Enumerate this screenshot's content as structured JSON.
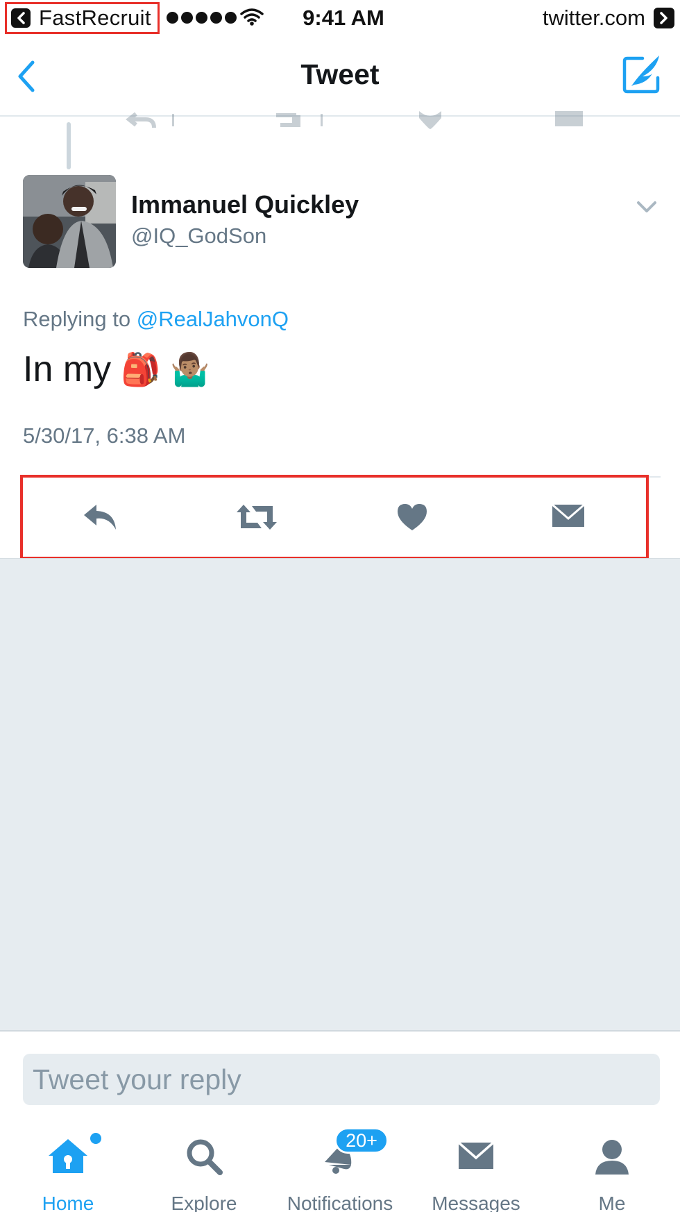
{
  "status_bar": {
    "back_app_label": "FastRecruit",
    "time": "9:41 AM",
    "site": "twitter.com"
  },
  "nav": {
    "title": "Tweet"
  },
  "tweet": {
    "author_name": "Immanuel Quickley",
    "author_handle": "@IQ_GodSon",
    "replying_prefix": "Replying to",
    "replying_to": "@RealJahvonQ",
    "text": "In my",
    "emoji": [
      "🎒",
      "🤷🏽‍♂️"
    ],
    "timestamp": "5/30/17, 6:38 AM"
  },
  "actions": [
    "reply",
    "retweet",
    "like",
    "direct-message"
  ],
  "reply": {
    "placeholder": "Tweet your reply"
  },
  "tab_bar": {
    "tabs": [
      {
        "label": "Home",
        "icon": "home-icon",
        "active": true
      },
      {
        "label": "Explore",
        "icon": "search-icon",
        "active": false
      },
      {
        "label": "Notifications",
        "icon": "bell-icon",
        "active": false,
        "badge": "20+"
      },
      {
        "label": "Messages",
        "icon": "envelope-icon",
        "active": false
      },
      {
        "label": "Me",
        "icon": "person-icon",
        "active": false
      }
    ]
  },
  "colors": {
    "accent": "#1da1f2",
    "icon_grey": "#657786",
    "highlight_box": "#e8302a",
    "background_grey": "#e6ecf0"
  }
}
